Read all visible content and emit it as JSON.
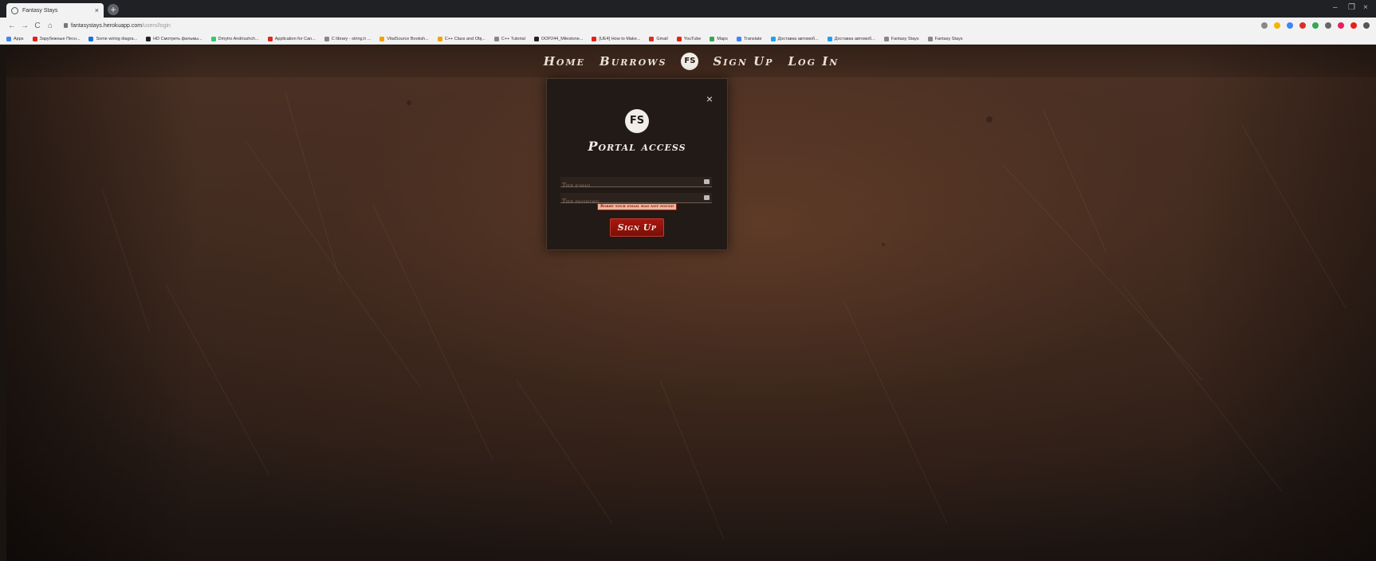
{
  "browser": {
    "tab_title": "Fantasy Stays",
    "tab_close": "×",
    "new_tab": "+",
    "url_host": "fantasystays.herokuapp.com",
    "url_path": "/users/login",
    "window_controls": [
      "–",
      "❐",
      "×"
    ],
    "nav": [
      "←",
      "→",
      "C",
      "⌂"
    ]
  },
  "bookmarks": [
    {
      "label": "Apps",
      "color": "#4285f4"
    },
    {
      "label": "Зарубежные Песн...",
      "color": "#e62117"
    },
    {
      "label": "Some wiring diagra...",
      "color": "#1e6fd9"
    },
    {
      "label": "HD Смотреть фильмы...",
      "color": "#222222"
    },
    {
      "label": "Dmytro Andriushch...",
      "color": "#2ecc71"
    },
    {
      "label": "Application for Can...",
      "color": "#d62d20"
    },
    {
      "label": "C library - string.h ...",
      "color": "#888888"
    },
    {
      "label": "VitalSource Booksh...",
      "color": "#f4a100"
    },
    {
      "label": "C++ Class and Obj...",
      "color": "#f4a100"
    },
    {
      "label": "C++ Tutorial",
      "color": "#888888"
    },
    {
      "label": "OOP244_Milestone...",
      "color": "#222222"
    },
    {
      "label": "[UE4] How to Make...",
      "color": "#e62117"
    },
    {
      "label": "Gmail",
      "color": "#d93025"
    },
    {
      "label": "YouTube",
      "color": "#e62117"
    },
    {
      "label": "Maps",
      "color": "#34a853"
    },
    {
      "label": "Translate",
      "color": "#4285f4"
    },
    {
      "label": "Доставка автомоб...",
      "color": "#1da1f2"
    },
    {
      "label": "Доставка автомоб...",
      "color": "#1da1f2"
    },
    {
      "label": "Fantasy Stays",
      "color": "#888888"
    },
    {
      "label": "Fantasy Stays",
      "color": "#888888"
    }
  ],
  "extensions": [
    "#888888",
    "#f4b400",
    "#4285f4",
    "#d93025",
    "#34a853",
    "#666666",
    "#e91e63",
    "#e62117",
    "#555555"
  ],
  "site_nav": {
    "home": "Home",
    "burrows": "Burrows",
    "logo": "FS",
    "signup": "Sign Up",
    "login": "Log In"
  },
  "modal": {
    "close": "×",
    "logo": "FS",
    "title": "Portal access",
    "email_placeholder": "Tier e-mail",
    "password_placeholder": "Tier password",
    "error": "Sorry your email was not found",
    "submit": "Sign Up"
  }
}
